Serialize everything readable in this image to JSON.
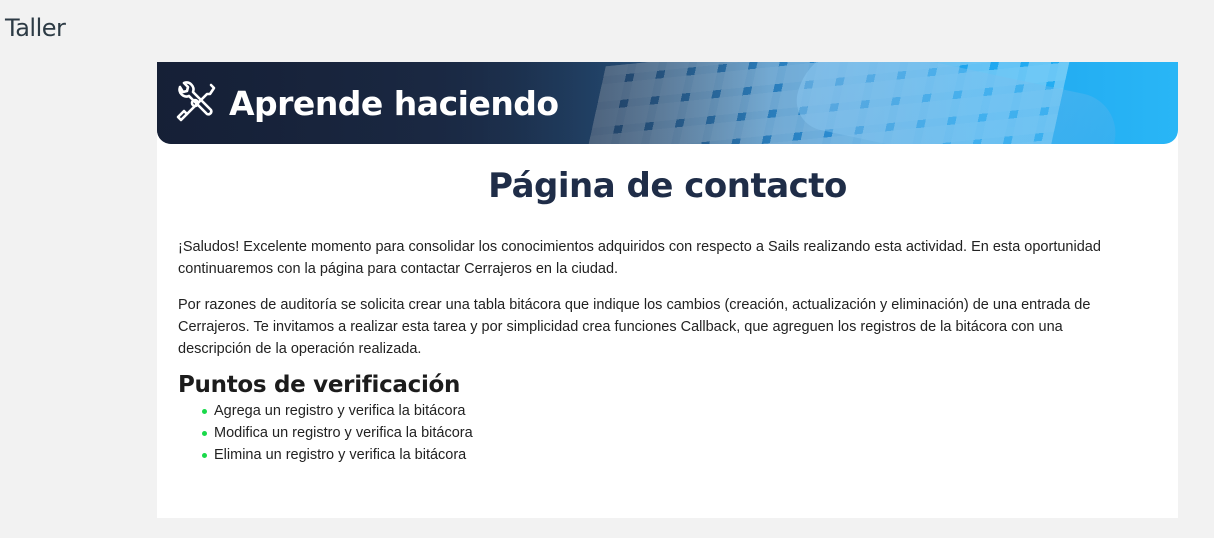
{
  "page": {
    "heading": "Taller"
  },
  "banner": {
    "title": "Aprende haciendo",
    "icon": "tools-icon"
  },
  "content": {
    "title": "Página de contacto",
    "paragraphs": [
      "¡Saludos! Excelente momento para consolidar los conocimientos adquiridos con respecto a Sails realizando esta actividad. En esta oportunidad continuaremos con la página para contactar Cerrajeros en la ciudad.",
      "Por razones de auditoría se solicita crear una tabla bitácora que indique los cambios (creación, actualización y eliminación) de una entrada de Cerrajeros. Te invitamos a realizar esta tarea y por simplicidad crea funciones Callback, que agreguen los registros de la bitácora con una descripción de la operación realizada."
    ],
    "checklist_title": "Puntos de verificación",
    "checklist": [
      "Agrega un registro y verifica la bitácora",
      "Modifica un registro y verifica la bitácora",
      "Elimina un registro y verifica la bitácora"
    ]
  },
  "colors": {
    "bullet": "#19d94a",
    "title": "#1f2d48",
    "banner_dark": "#1d2a44",
    "banner_light": "#29b6f6"
  }
}
